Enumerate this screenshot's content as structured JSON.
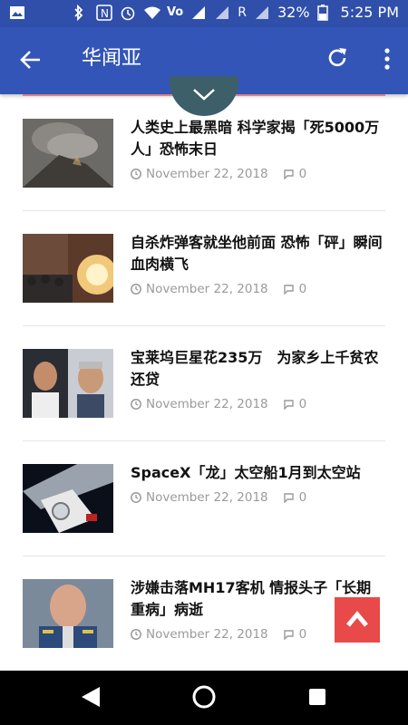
{
  "statusbar": {
    "signal_label": "R",
    "battery": "32%",
    "time": "5:25 PM"
  },
  "appbar": {
    "title": "华闻亚"
  },
  "articles": [
    {
      "title": "人类史上最黑暗 科学家揭「死5000万人」恐怖末日",
      "date": "November 22, 2018",
      "comments": "0"
    },
    {
      "title": "自杀炸弹客就坐他前面 恐怖「砰」瞬间血肉横飞",
      "date": "November 22, 2018",
      "comments": "0"
    },
    {
      "title": "宝莱坞巨星花235万　为家乡上千贫农还贷",
      "date": "November 22, 2018",
      "comments": "0"
    },
    {
      "title": "SpaceX「龙」太空船1月到太空站",
      "date": "November 22, 2018",
      "comments": "0"
    },
    {
      "title": "涉嫌击落MH17客机 情报头子「长期重病」病逝",
      "date": "November 22, 2018",
      "comments": "0"
    }
  ],
  "colors": {
    "appbar": "#3355b8",
    "statusbar": "#2f4faa",
    "totop": "#e84a4a"
  }
}
